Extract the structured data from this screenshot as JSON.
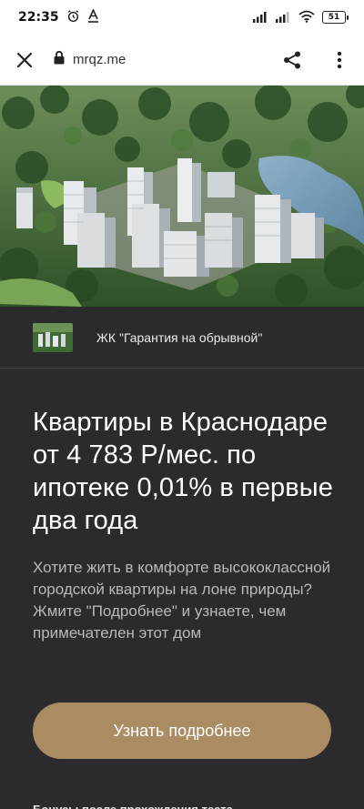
{
  "status_bar": {
    "time": "22:35",
    "battery": "51",
    "icons": [
      "alarm-icon",
      "text-a-icon",
      "signal-icon",
      "signal-icon",
      "wifi-icon",
      "battery-icon"
    ]
  },
  "browser": {
    "url": "mrqz.me",
    "icons": [
      "close-icon",
      "lock-icon",
      "share-icon",
      "more-vert-icon"
    ]
  },
  "site_header": {
    "title": "ЖК \"Гарантия на обрывной\""
  },
  "content": {
    "headline": "Квартиры в Краснодаре от 4 783 Р/мес. по ипотеке 0,01% в первые два года",
    "description": "Хотите жить в комфорте высококлассной городской квартиры на лоне природы? Жмите \"Подробнее\" и узнаете, чем примечателен этот дом",
    "cta_label": "Узнать подробнее",
    "bottom_text": "Бонусы после прохождения теста"
  },
  "colors": {
    "background": "#2b2a2c",
    "cta": "#aa8c63",
    "headline": "#ffffff",
    "description": "#b9b9bb"
  }
}
